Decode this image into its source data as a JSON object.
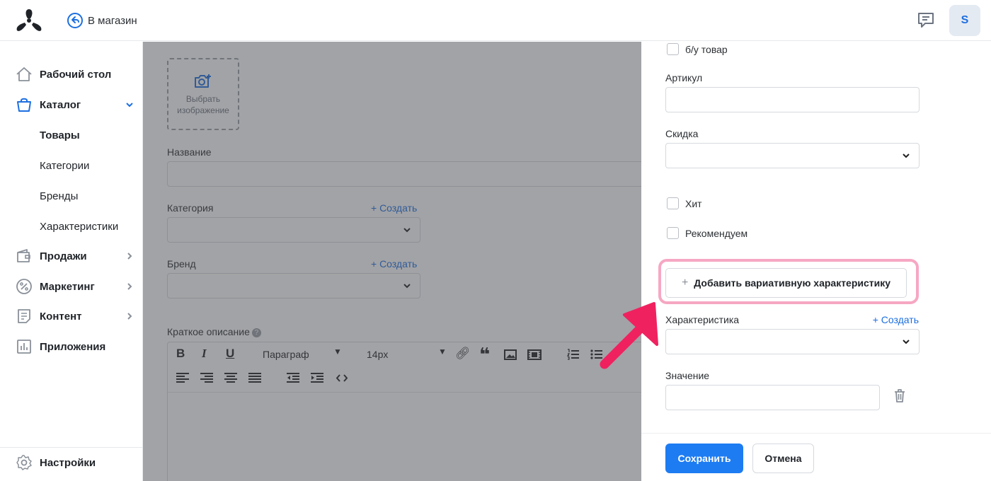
{
  "header": {
    "back_label": "В магазин",
    "avatar_letter": "S"
  },
  "sidebar": {
    "items": [
      {
        "label": "Рабочий стол",
        "icon": "home-icon"
      },
      {
        "label": "Каталог",
        "icon": "bag-icon",
        "expanded": true
      },
      {
        "label": "Продажи",
        "icon": "wallet-icon"
      },
      {
        "label": "Маркетинг",
        "icon": "percent-icon"
      },
      {
        "label": "Контент",
        "icon": "document-icon"
      },
      {
        "label": "Приложения",
        "icon": "chart-icon"
      }
    ],
    "catalog_sub": [
      "Товары",
      "Категории",
      "Бренды",
      "Характеристики"
    ],
    "settings_label": "Настройки"
  },
  "main": {
    "upload_label_1": "Выбрать",
    "upload_label_2": "изображение",
    "name_label": "Название",
    "category_label": "Категория",
    "brand_label": "Бренд",
    "create_label": "+ Создать",
    "short_desc_label": "Краткое описание",
    "editor": {
      "paragraph": "Параграф",
      "font_size": "14px"
    }
  },
  "panel": {
    "used_label": "б/у товар",
    "sku_label": "Артикул",
    "discount_label": "Скидка",
    "hit_label": "Хит",
    "recommend_label": "Рекомендуем",
    "add_variant_label": "Добавить вариативную характеристику",
    "characteristic_label": "Характеристика",
    "create_label": "+ Создать",
    "value_label": "Значение",
    "save_label": "Сохранить",
    "cancel_label": "Отмена"
  },
  "colors": {
    "accent": "#1d7cf2",
    "highlight": "#f6a7c3",
    "annotation_arrow": "#f0215f"
  }
}
